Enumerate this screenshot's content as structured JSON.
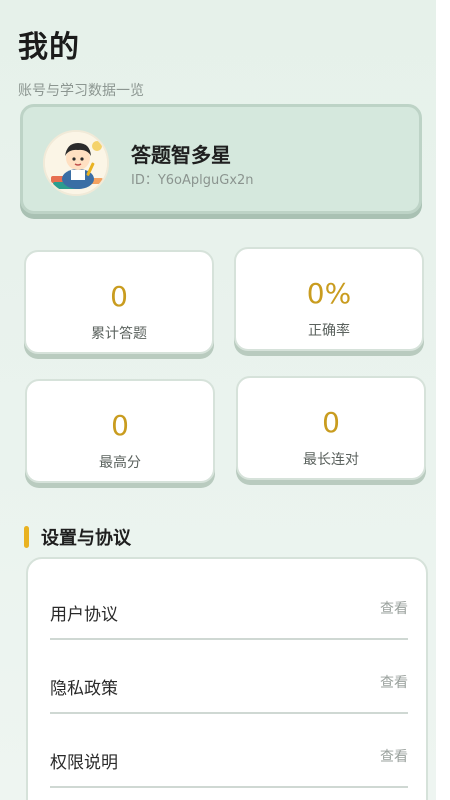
{
  "header": {
    "title": "我的",
    "subtitle": "账号与学习数据一览"
  },
  "profile": {
    "avatar_icon": "cartoon-student-avatar",
    "nickname": "答题智多星",
    "uid": "ID：Y6oAplguGx2n"
  },
  "stats": [
    {
      "value": "0",
      "label": "累计答题"
    },
    {
      "value": "0%",
      "label": "正确率"
    },
    {
      "value": "0",
      "label": "最高分"
    },
    {
      "value": "0",
      "label": "最长连对"
    }
  ],
  "settings": {
    "title": "设置与协议",
    "items": [
      {
        "label": "用户协议",
        "action": "查看"
      },
      {
        "label": "隐私政策",
        "action": "查看"
      },
      {
        "label": "权限说明",
        "action": "查看"
      }
    ]
  },
  "colors": {
    "accent": "#c99c1f",
    "section_bar": "#e9b221",
    "profile_bg": "#d5e8dd",
    "page_bg": "#e6f1ea"
  }
}
